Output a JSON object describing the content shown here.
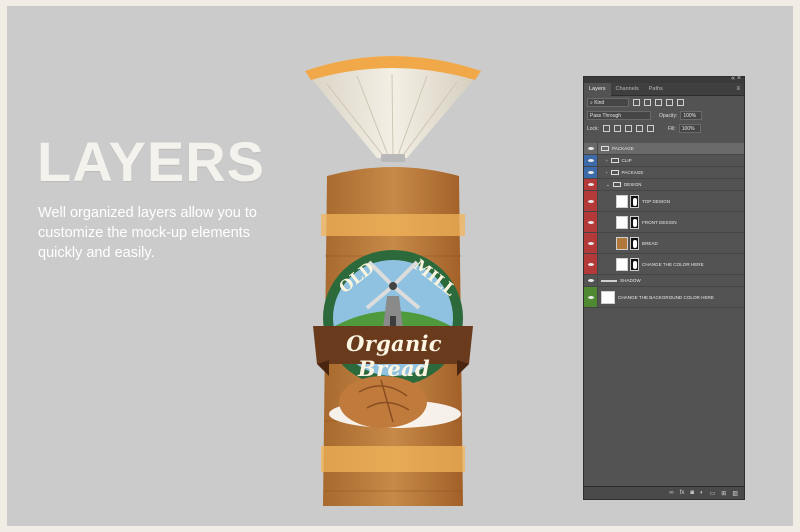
{
  "headline": "LAYERS",
  "description": "Well organized layers allow you to customize the mock-up elements quickly and easily.",
  "product": {
    "brand_left": "OLD",
    "brand_right": "MILL",
    "banner": "Organic Bread"
  },
  "panel": {
    "tabs": [
      "Layers",
      "Channels",
      "Paths"
    ],
    "filter_label": "Kind",
    "blend_mode": "Pass Through",
    "opacity_label": "Opacity:",
    "opacity_value": "100%",
    "lock_label": "Lock:",
    "fill_label": "Fill:",
    "fill_value": "100%",
    "layers": [
      {
        "name": "PACKAGE",
        "indent": 0,
        "color": "none",
        "kind": "group",
        "selected": true
      },
      {
        "name": "CLIP",
        "indent": 1,
        "color": "blue",
        "kind": "group"
      },
      {
        "name": "PACKAGE",
        "indent": 1,
        "color": "blue",
        "kind": "group"
      },
      {
        "name": "DESIGN",
        "indent": 1,
        "color": "red",
        "kind": "group"
      },
      {
        "name": "TOP DESIGN",
        "indent": 2,
        "color": "red",
        "kind": "smart"
      },
      {
        "name": "FRONT DESIGN",
        "indent": 2,
        "color": "red",
        "kind": "smart"
      },
      {
        "name": "BREAD",
        "indent": 2,
        "color": "red",
        "kind": "image"
      },
      {
        "name": "CHANGE THE COLOR HERE",
        "indent": 2,
        "color": "red",
        "kind": "fill"
      },
      {
        "name": "SHADOW",
        "indent": 0,
        "color": "none",
        "kind": "shadow"
      },
      {
        "name": "CHANGE THE BACKGROUND COLOR HERE",
        "indent": 0,
        "color": "green",
        "kind": "fill"
      }
    ]
  },
  "colors": {
    "canvas_bg": "#cbcbcb",
    "panel_bg": "#535353",
    "tag_blue": "#3d6aa8",
    "tag_red": "#b43a3a",
    "tag_green": "#4f8a32"
  }
}
